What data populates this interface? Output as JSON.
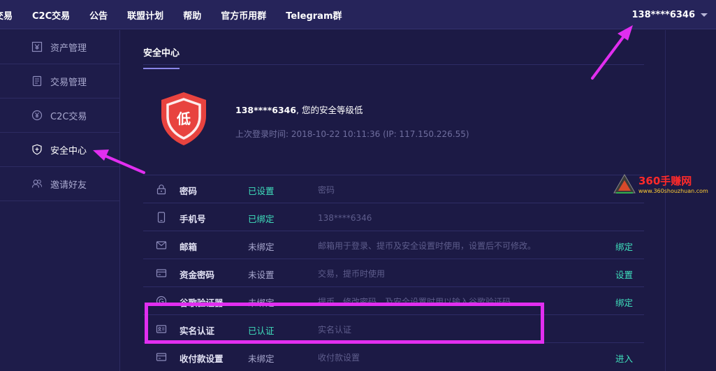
{
  "topnav": {
    "items": [
      "交易",
      "C2C交易",
      "公告",
      "联盟计划",
      "帮助",
      "官方币用群",
      "Telegram群"
    ],
    "user": "138****6346"
  },
  "sidebar": {
    "items": [
      {
        "label": "资产管理",
        "icon": "yen-box-icon"
      },
      {
        "label": "交易管理",
        "icon": "document-icon"
      },
      {
        "label": "C2C交易",
        "icon": "yen-circle-icon"
      },
      {
        "label": "安全中心",
        "icon": "shield-icon",
        "active": true
      },
      {
        "label": "邀请好友",
        "icon": "users-icon"
      }
    ]
  },
  "main": {
    "tab": "安全中心",
    "shield_char": "低",
    "security_phone": "138****6346",
    "security_suffix": ", 您的安全等级低",
    "last_login": "上次登录时间: 2018-10-22 10:11:36 (IP: 117.150.226.55)",
    "rows": [
      {
        "name": "密码",
        "status": "已设置",
        "status_ok": true,
        "desc": "密码",
        "action": ""
      },
      {
        "name": "手机号",
        "status": "已绑定",
        "status_ok": true,
        "desc": "138****6346",
        "action": ""
      },
      {
        "name": "邮箱",
        "status": "未绑定",
        "status_ok": false,
        "desc": "邮箱用于登录、提币及安全设置时使用，设置后不可修改。",
        "action": "绑定"
      },
      {
        "name": "资金密码",
        "status": "未设置",
        "status_ok": false,
        "desc": "交易，提币时使用",
        "action": "设置"
      },
      {
        "name": "谷歌验证器",
        "status": "未绑定",
        "status_ok": false,
        "desc": "提币、修改密码，及安全设置时用以输入谷歌验证码",
        "action": "绑定"
      },
      {
        "name": "实名认证",
        "status": "已认证",
        "status_ok": true,
        "desc": "实名认证",
        "action": ""
      },
      {
        "name": "收付款设置",
        "status": "未绑定",
        "status_ok": false,
        "desc": "收付款设置",
        "action": "进入"
      }
    ]
  },
  "watermark": {
    "title": "360手赚网",
    "sub": "www.360shouzhuan.com"
  },
  "colors": {
    "accent": "#3fe0bd",
    "highlight": "#e12ef0",
    "shield": "#e8433f",
    "background": "#1c1a45"
  }
}
